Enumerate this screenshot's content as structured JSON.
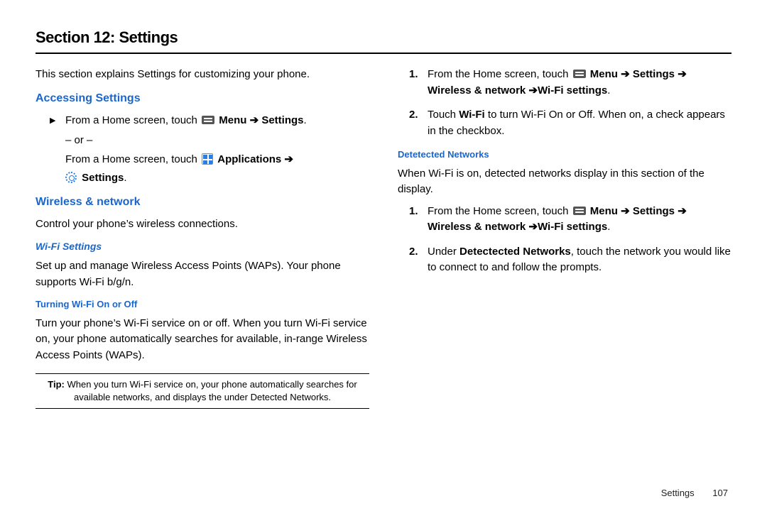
{
  "title": "Section 12: Settings",
  "intro": "This section explains Settings for customizing your phone.",
  "accessing": {
    "heading": "Accessing Settings",
    "line1_pre": "From a Home screen, touch ",
    "line1_menu": "Menu",
    "line1_arrow": " ➔ ",
    "line1_settings": "Settings",
    "line1_dot": ".",
    "or": "– or –",
    "line2_pre": "From a Home screen, touch ",
    "line2_apps": "Applications",
    "line2_arrow": " ➔",
    "line3_settings": "Settings",
    "line3_dot": "."
  },
  "wireless": {
    "heading": "Wireless & network",
    "desc": "Control your phone’s wireless connections.",
    "wifi_h": "Wi-Fi Settings",
    "wifi_desc": "Set up and manage Wireless Access Points (WAPs). Your phone supports Wi-Fi  b/g/n.",
    "turn_h": "Turning Wi-Fi On or Off",
    "turn_desc": "Turn your phone’s Wi-Fi service on or off. When you turn Wi-Fi service on, your phone automatically searches for available, in-range Wireless Access Points (WAPs)."
  },
  "tip": {
    "label": "Tip:",
    "text": " When you turn Wi-Fi service on, your phone automatically searches for available networks, and displays the under Detected Networks."
  },
  "right": {
    "step1_num": "1.",
    "step1_pre": "From the Home screen, touch ",
    "step1_menu": "Menu",
    "step1_a1": " ➔ ",
    "step1_set": "Settings",
    "step1_a2": " ➔ ",
    "step1_wn": "Wireless & network",
    "step1_a3": " ➔",
    "step1_wifi": "Wi-Fi settings",
    "step1_dot": ".",
    "step2_num": "2.",
    "step2_pre": "Touch ",
    "step2_wifi": "Wi-Fi",
    "step2_post": " to turn Wi-Fi On or Off. When on, a check appears in the checkbox.",
    "det_h": "Detetected Networks",
    "det_desc": "When Wi-Fi is on, detected networks display in this section of the display.",
    "d1_num": "1.",
    "d1_pre": "From the Home screen, touch ",
    "d1_menu": "Menu",
    "d1_a1": " ➔ ",
    "d1_set": "Settings",
    "d1_a2": " ➔ ",
    "d1_wn": "Wireless & network",
    "d1_a3": " ➔",
    "d1_wifi": "Wi-Fi settings",
    "d1_dot": ".",
    "d2_num": "2.",
    "d2_pre": "Under ",
    "d2_bold": "Detectected Networks",
    "d2_post": ", touch the network you would like to connect to and follow the prompts."
  },
  "footer": {
    "label": "Settings",
    "page": "107"
  }
}
